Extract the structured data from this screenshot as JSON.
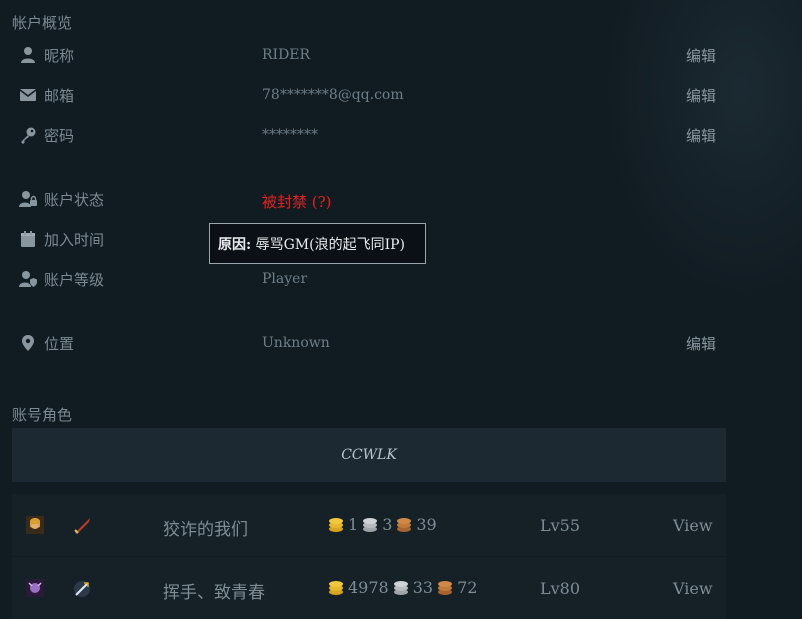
{
  "account_overview": {
    "title": "帐户概览",
    "fields": [
      {
        "icon": "user-icon",
        "label": "昵称",
        "value": "RIDER",
        "edit": "编辑"
      },
      {
        "icon": "envelope-icon",
        "label": "邮箱",
        "value": "78*******8@qq.com",
        "edit": "编辑"
      },
      {
        "icon": "key-icon",
        "label": "密码",
        "value": "********",
        "edit": "编辑"
      },
      {
        "icon": "user-lock-icon",
        "label": "账户状态",
        "value": "被封禁 (?)"
      },
      {
        "icon": "calendar-icon",
        "label": "加入时间",
        "value": ""
      },
      {
        "icon": "user-shield-icon",
        "label": "账户等级",
        "value": "Player"
      },
      {
        "icon": "map-pin-icon",
        "label": "位置",
        "value": "Unknown",
        "edit": "编辑"
      }
    ],
    "tooltip": {
      "prefix": "原因:",
      "text": "辱骂GM(浪的起飞同IP)"
    }
  },
  "characters": {
    "title": "账号角色",
    "realm": "CCWLK",
    "list": [
      {
        "race_icon": "human-female-icon",
        "class_icon": "warrior-sword-icon",
        "name": "狡诈的我们",
        "gold": "1",
        "silver": "3",
        "copper": "39",
        "level": "Lv55",
        "view": "View"
      },
      {
        "race_icon": "nightelf-female-icon",
        "class_icon": "deathknight-icon",
        "name": "挥手、致青春",
        "gold": "4978",
        "silver": "33",
        "copper": "72",
        "level": "Lv80",
        "view": "View"
      }
    ]
  },
  "colors": {
    "banned": "#e02424",
    "gold": "#d9a520",
    "silver": "#b8bcc0",
    "copper": "#c07a3a"
  }
}
